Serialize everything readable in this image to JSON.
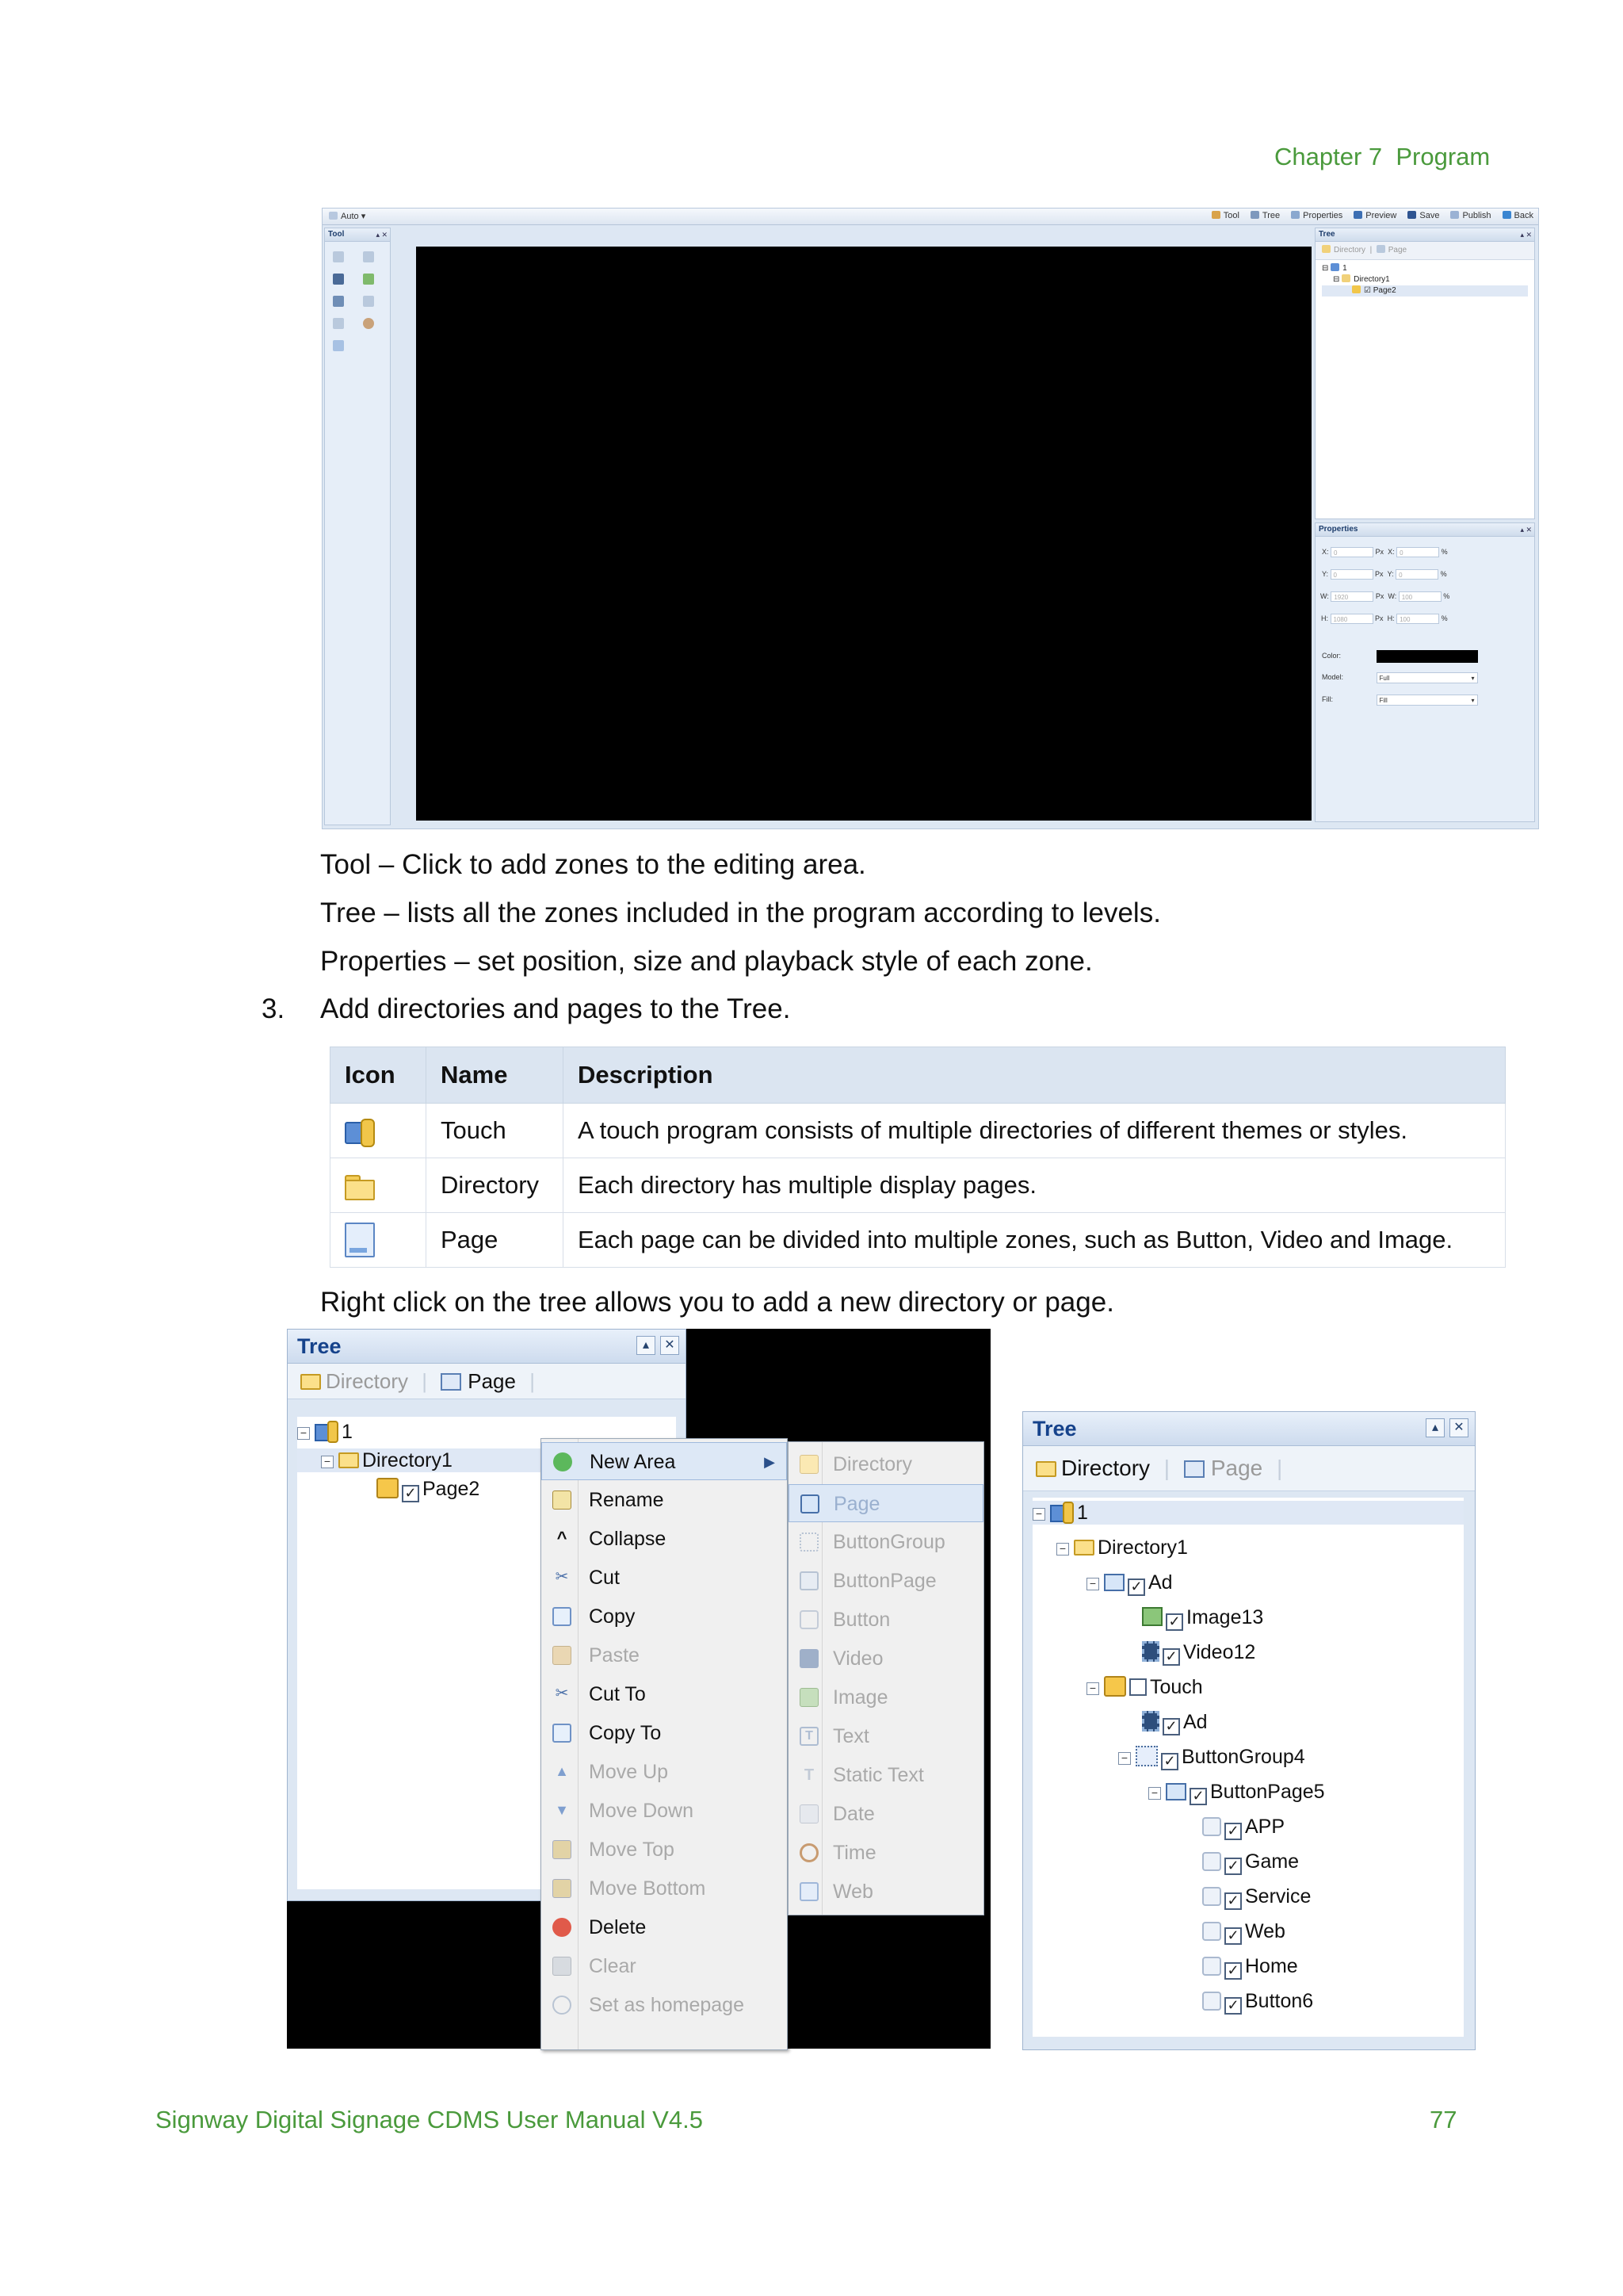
{
  "header": {
    "chapter": "Chapter 7  Program"
  },
  "screenshot1": {
    "toolbar_auto": "Auto",
    "toolbar_buttons": [
      "Tool",
      "Tree",
      "Properties",
      "Preview",
      "Save",
      "Publish",
      "Back"
    ],
    "tool_panel_title": "Tool",
    "tree_panel_title": "Tree",
    "tree_toolbar": {
      "directory": "Directory",
      "page": "Page"
    },
    "tree_nodes": [
      "1",
      "Directory1",
      "Page2"
    ],
    "properties_title": "Properties",
    "properties": {
      "x_label": "X:",
      "y_label": "Y:",
      "w_label": "W:",
      "h_label": "H:",
      "px_x": "0",
      "px_y": "0",
      "px_w": "1920",
      "px_h": "1080",
      "pct_x": "0",
      "pct_y": "0",
      "pct_w": "100",
      "pct_h": "100",
      "px_unit": "Px",
      "pct_unit": "%",
      "color_label": "Color:",
      "color_value": "#000000",
      "model_label": "Model:",
      "model_value": "Full",
      "fill_label": "Fill:",
      "fill_value": "Fill"
    }
  },
  "body": {
    "line_tool": "Tool – Click to add zones to the editing area.",
    "line_tree": "Tree – lists all the zones included in the program according to levels.",
    "line_properties": "Properties – set position, size and playback style of each zone.",
    "step_number": "3.",
    "step_text": "Add directories and pages to the Tree.",
    "right_click_text": "Right click on the tree allows you to add a new directory or page."
  },
  "table": {
    "headers": [
      "Icon",
      "Name",
      "Description"
    ],
    "rows": [
      {
        "icon": "touch-icon",
        "name": "Touch",
        "description": "A touch program consists of multiple directories of different themes or styles."
      },
      {
        "icon": "folder-icon",
        "name": "Directory",
        "description": "Each directory has multiple display pages."
      },
      {
        "icon": "page-icon",
        "name": "Page",
        "description": "Each page can be divided into multiple zones, such as Button, Video and Image."
      }
    ]
  },
  "screenshot2": {
    "tree_title": "Tree",
    "toolbar": {
      "directory": "Directory",
      "page": "Page"
    },
    "nodes": [
      "1",
      "Directory1",
      "Page2"
    ],
    "context_menu": [
      "New Area",
      "Rename",
      "Collapse",
      "Cut",
      "Copy",
      "Paste",
      "Cut To",
      "Copy To",
      "Move Up",
      "Move Down",
      "Move Top",
      "Move Bottom",
      "Delete",
      "Clear",
      "Set as homepage"
    ],
    "submenu": [
      "Directory",
      "Page",
      "ButtonGroup",
      "ButtonPage",
      "Button",
      "Video",
      "Image",
      "Text",
      "Static Text",
      "Date",
      "Time",
      "Web"
    ]
  },
  "screenshot3": {
    "tree_title": "Tree",
    "toolbar": {
      "directory": "Directory",
      "page": "Page"
    },
    "nodes": [
      "1",
      "Directory1",
      "Ad",
      "Image13",
      "Video12",
      "Touch",
      "Ad",
      "ButtonGroup4",
      "ButtonPage5",
      "APP",
      "Game",
      "Service",
      "Web",
      "Home",
      "Button6"
    ]
  },
  "footer": {
    "manual_title": "Signway Digital Signage CDMS User Manual V4.5",
    "page_number": "77"
  }
}
